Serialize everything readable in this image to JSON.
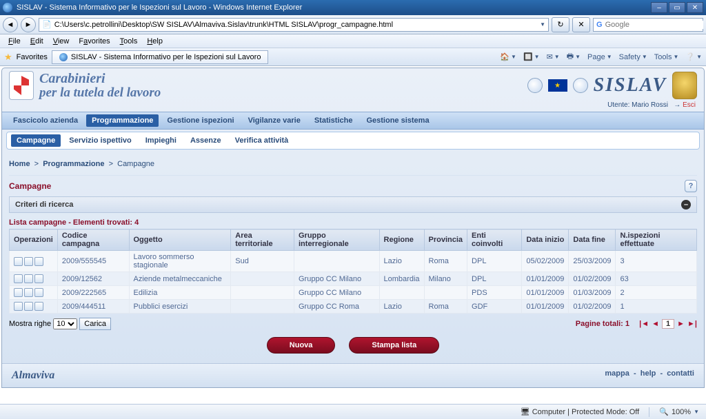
{
  "window": {
    "title": "SISLAV - Sistema Informativo per le Ispezioni sul Lavoro - Windows Internet Explorer",
    "address": "C:\\Users\\c.petrollini\\Desktop\\SW SISLAV\\Almaviva.Sislav\\trunk\\HTML SISLAV\\progr_campagne.html",
    "search_placeholder": "Google"
  },
  "menus": [
    "File",
    "Edit",
    "View",
    "Favorites",
    "Tools",
    "Help"
  ],
  "favbar": {
    "favorites": "Favorites",
    "tab": "SISLAV - Sistema Informativo per le Ispezioni sul Lavoro",
    "tools": [
      "Page",
      "Safety",
      "Tools"
    ]
  },
  "brand": {
    "l1": "Carabinieri",
    "l2": "per la tutela del lavoro",
    "product": "SISLAV"
  },
  "user": {
    "label": "Utente: Mario Rossi",
    "exit": "Esci"
  },
  "mainnav": [
    "Fascicolo azienda",
    "Programmazione",
    "Gestione ispezioni",
    "Vigilanze varie",
    "Statistiche",
    "Gestione sistema"
  ],
  "mainnav_active": 1,
  "subnav": [
    "Campagne",
    "Servizio ispettivo",
    "Impieghi",
    "Assenze",
    "Verifica attività"
  ],
  "subnav_active": 0,
  "breadcrumb": [
    "Home",
    "Programmazione",
    "Campagne"
  ],
  "page_title": "Campagne",
  "criteria_label": "Criteri di ricerca",
  "list_header": "Lista campagne - Elementi trovati: 4",
  "columns": [
    "Operazioni",
    "Codice campagna",
    "Oggetto",
    "Area territoriale",
    "Gruppo interregionale",
    "Regione",
    "Provincia",
    "Enti coinvolti",
    "Data inizio",
    "Data fine",
    "N.ispezioni effettuate"
  ],
  "rows": [
    {
      "codice": "2009/555545",
      "oggetto": "Lavoro sommerso stagionale",
      "area": "Sud",
      "gruppo": "",
      "regione": "Lazio",
      "provincia": "Roma",
      "enti": "DPL",
      "inizio": "05/02/2009",
      "fine": "25/03/2009",
      "nisp": "3"
    },
    {
      "codice": "2009/12562",
      "oggetto": "Aziende metalmeccaniche",
      "area": "",
      "gruppo": "Gruppo CC Milano",
      "regione": "Lombardia",
      "provincia": "Milano",
      "enti": "DPL",
      "inizio": "01/01/2009",
      "fine": "01/02/2009",
      "nisp": "63"
    },
    {
      "codice": "2009/222565",
      "oggetto": "Edilizia",
      "area": "",
      "gruppo": "Gruppo CC Milano",
      "regione": "",
      "provincia": "",
      "enti": "PDS",
      "inizio": "01/01/2009",
      "fine": "01/03/2009",
      "nisp": "2"
    },
    {
      "codice": "2009/444511",
      "oggetto": "Pubblici esercizi",
      "area": "",
      "gruppo": "Gruppo CC Roma",
      "regione": "Lazio",
      "provincia": "Roma",
      "enti": "GDF",
      "inizio": "01/01/2009",
      "fine": "01/02/2009",
      "nisp": "1"
    }
  ],
  "pager": {
    "rows_label": "Mostra righe",
    "rows_value": "10",
    "load": "Carica",
    "total_label": "Pagine totali: 1",
    "current": "1"
  },
  "actions": {
    "new": "Nuova",
    "print": "Stampa lista"
  },
  "footer": {
    "brand": "Almaviva",
    "links": [
      "mappa",
      "help",
      "contatti"
    ]
  },
  "status": {
    "mode": "Computer | Protected Mode: Off",
    "zoom": "100%"
  }
}
